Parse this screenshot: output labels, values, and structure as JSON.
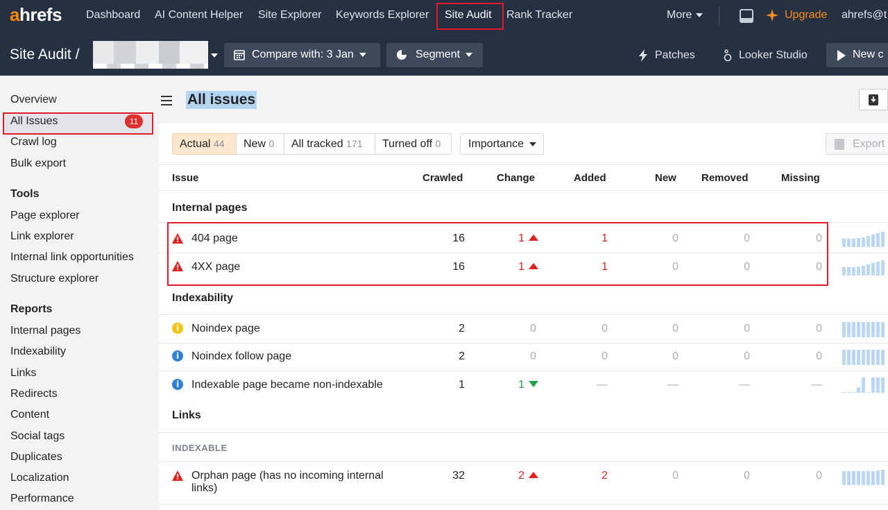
{
  "topnav": {
    "logo": "ahrefs",
    "items": [
      "Dashboard",
      "AI Content Helper",
      "Site Explorer",
      "Keywords Explorer",
      "Site Audit",
      "Rank Tracker"
    ],
    "more": "More",
    "upgrade": "Upgrade",
    "account": "ahrefs@t"
  },
  "subbar": {
    "title": "Site Audit",
    "separator": "/",
    "compare": "Compare with: 3 Jan",
    "segment": "Segment",
    "patches": "Patches",
    "looker": "Looker Studio",
    "new": "New c"
  },
  "sidebar": {
    "items_top": [
      "Overview",
      "All Issues",
      "Crawl log",
      "Bulk export"
    ],
    "issues_count": "11",
    "tools_head": "Tools",
    "tools": [
      "Page explorer",
      "Link explorer",
      "Internal link opportunities",
      "Structure explorer"
    ],
    "reports_head": "Reports",
    "reports": [
      "Internal pages",
      "Indexability",
      "Links",
      "Redirects",
      "Content",
      "Social tags",
      "Duplicates",
      "Localization",
      "Performance"
    ]
  },
  "main": {
    "title": "All issues",
    "filters": [
      {
        "label": "Actual",
        "count": "44"
      },
      {
        "label": "New",
        "count": "0"
      },
      {
        "label": "All tracked",
        "count": "171"
      },
      {
        "label": "Turned off",
        "count": "0"
      }
    ],
    "importance": "Importance",
    "export": "Export",
    "columns": [
      "Issue",
      "Crawled",
      "Change",
      "Added",
      "New",
      "Removed",
      "Missing"
    ],
    "groups": {
      "internal": "Internal pages",
      "indexability": "Indexability",
      "links": "Links",
      "indexable": "INDEXABLE"
    },
    "rows": [
      {
        "name": "404 page",
        "crawled": "16",
        "change": "1",
        "added": "1",
        "new": "0",
        "removed": "0",
        "missing": "0"
      },
      {
        "name": "4XX page",
        "crawled": "16",
        "change": "1",
        "added": "1",
        "new": "0",
        "removed": "0",
        "missing": "0"
      },
      {
        "name": "Noindex page",
        "crawled": "2",
        "change": "0",
        "added": "0",
        "new": "0",
        "removed": "0",
        "missing": "0"
      },
      {
        "name": "Noindex follow page",
        "crawled": "2",
        "change": "0",
        "added": "0",
        "new": "0",
        "removed": "0",
        "missing": "0"
      },
      {
        "name": "Indexable page became non-indexable",
        "crawled": "1",
        "change": "1",
        "added": "—",
        "new": "—",
        "removed": "—",
        "missing": "—"
      },
      {
        "name": "Orphan page (has no incoming internal",
        "name2": "links)",
        "crawled": "32",
        "change": "2",
        "added": "2",
        "new": "0",
        "removed": "0",
        "missing": "0"
      }
    ]
  },
  "colors": {
    "nav_bg": "#253142",
    "accent_orange": "#ff8800",
    "highlight_red": "#e01b2a",
    "error_red": "#e0201f",
    "info_blue": "#2f80d8",
    "warning_yellow": "#f5c30b"
  }
}
